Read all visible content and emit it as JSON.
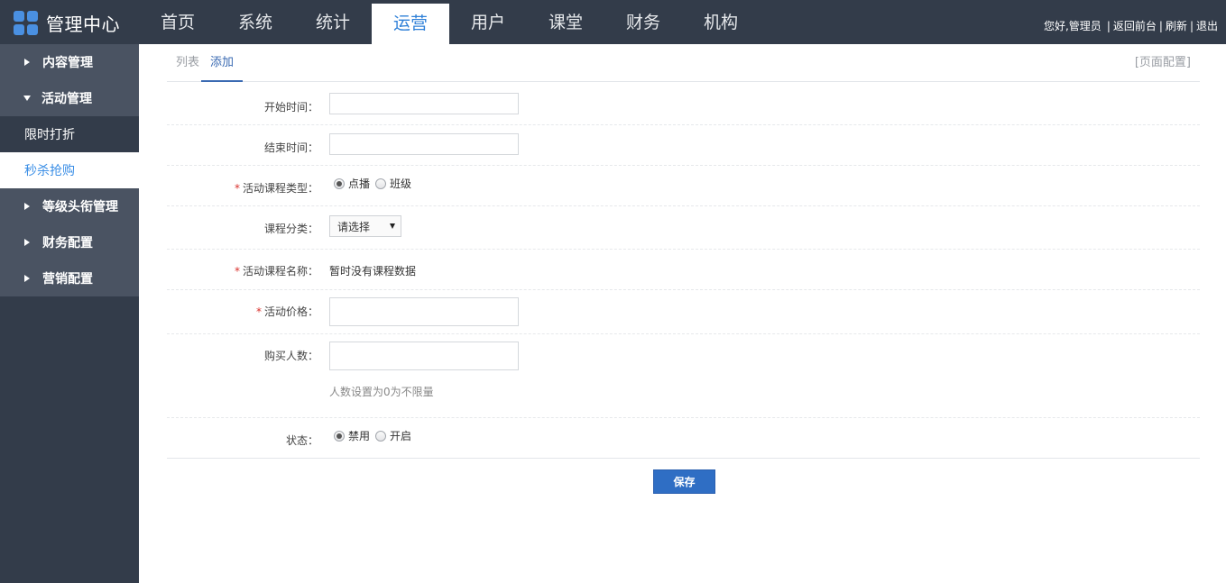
{
  "brand": {
    "title": "管理中心",
    "icon": "grid-logo-icon",
    "color": "#4a90e2"
  },
  "nav": {
    "items": [
      {
        "label": "首页"
      },
      {
        "label": "系统"
      },
      {
        "label": "统计"
      },
      {
        "label": "运营",
        "active": true
      },
      {
        "label": "用户"
      },
      {
        "label": "课堂"
      },
      {
        "label": "财务"
      },
      {
        "label": "机构"
      }
    ]
  },
  "user": {
    "greeting": "您好,管理员",
    "sep": "|",
    "back_label": "返回前台",
    "refresh_label": "刷新",
    "logout_label": "退出"
  },
  "sidebar": {
    "items": [
      {
        "label": "内容管理",
        "type": "group",
        "expanded": false
      },
      {
        "label": "活动管理",
        "type": "group",
        "expanded": true
      },
      {
        "label": "限时打折",
        "type": "sub"
      },
      {
        "label": "秒杀抢购",
        "type": "sub",
        "active": true
      },
      {
        "label": "等级头衔管理",
        "type": "group",
        "expanded": false
      },
      {
        "label": "财务配置",
        "type": "group",
        "expanded": false
      },
      {
        "label": "营销配置",
        "type": "group",
        "expanded": false
      }
    ]
  },
  "tabs": {
    "list_label": "列表",
    "add_label": "添加",
    "page_config_label": "[页面配置]"
  },
  "form": {
    "required_mark": "*",
    "start_time": {
      "label": "开始时间：",
      "value": ""
    },
    "end_time": {
      "label": "结束时间：",
      "value": ""
    },
    "course_type": {
      "label": "活动课程类型：",
      "options": [
        "点播",
        "班级"
      ],
      "selected": "点播"
    },
    "category": {
      "label": "课程分类：",
      "selected": "请选择"
    },
    "course_name": {
      "label": "活动课程名称：",
      "value": "暂时没有课程数据"
    },
    "price": {
      "label": "活动价格：",
      "value": ""
    },
    "buyers": {
      "label": "购买人数：",
      "value": "",
      "hint": "人数设置为0为不限量"
    },
    "status": {
      "label": "状态：",
      "options": [
        "禁用",
        "开启"
      ],
      "selected": "禁用"
    },
    "save_label": "保存"
  },
  "colors": {
    "header_bg": "#333c4a",
    "sidebar_group_bg": "#4a5362",
    "accent": "#2f80d8",
    "button": "#2f6ec4",
    "required": "#d9322e"
  }
}
